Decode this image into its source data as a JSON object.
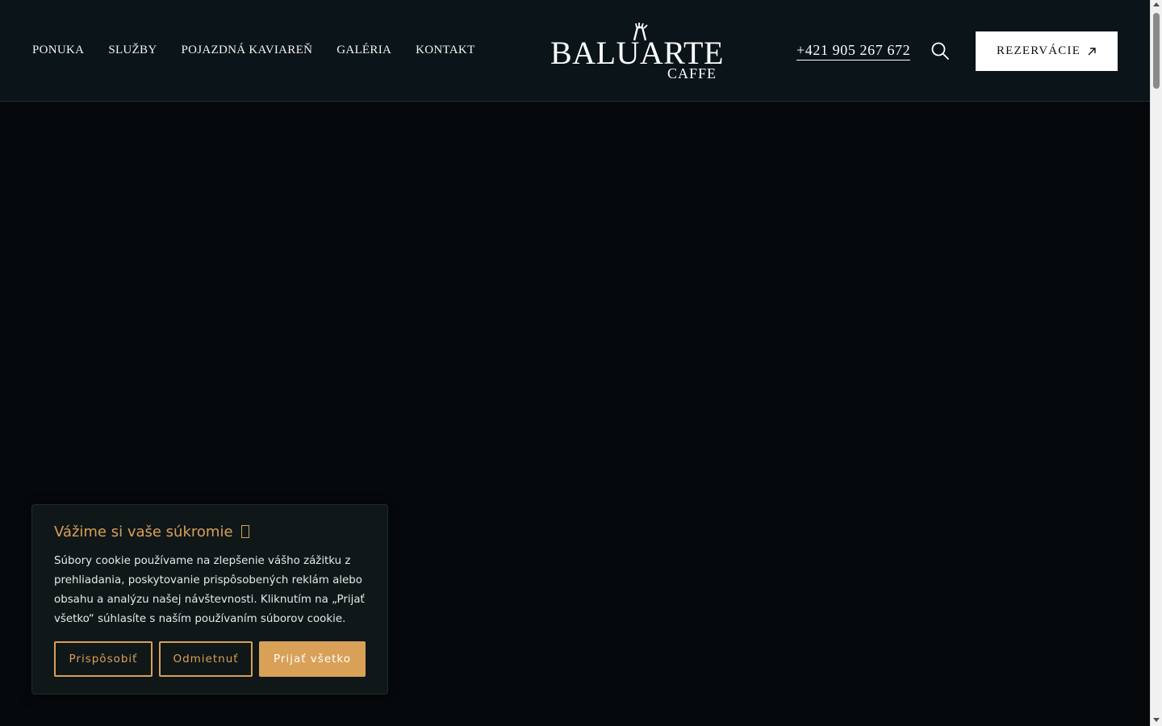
{
  "nav": {
    "items": [
      {
        "label": "PONUKA"
      },
      {
        "label": "SLUŽBY"
      },
      {
        "label": "POJAZDNÁ KAVIAREŇ"
      },
      {
        "label": "GALÉRIA"
      },
      {
        "label": "KONTAKT"
      }
    ]
  },
  "logo": {
    "name": "BALUARTE",
    "sub": "CAFFE"
  },
  "header": {
    "phone": "+421 905 267 672",
    "reserve_label": "REZERVÁCIE",
    "search_icon": "search-icon",
    "reserve_icon": "arrow-up-right-icon"
  },
  "cookie": {
    "title": "Vážime si vaše súkromie",
    "title_icon": "cookie-icon",
    "text": "Súbory cookie používame na zlepšenie vášho zážitku z prehliadania, poskytovanie prispôsobených reklám alebo obsahu a analýzu našej návštevnosti. Kliknutím na „Prijať všetko“ súhlasíte s naším používaním súborov cookie.",
    "customize_label": "Prispôsobiť",
    "reject_label": "Odmietnuť",
    "accept_label": "Prijať všetko"
  },
  "colors": {
    "header_bg": "#0b1418",
    "page_bg": "#05090b",
    "accent": "#d9a057",
    "cookie_bg": "#0f1719"
  }
}
